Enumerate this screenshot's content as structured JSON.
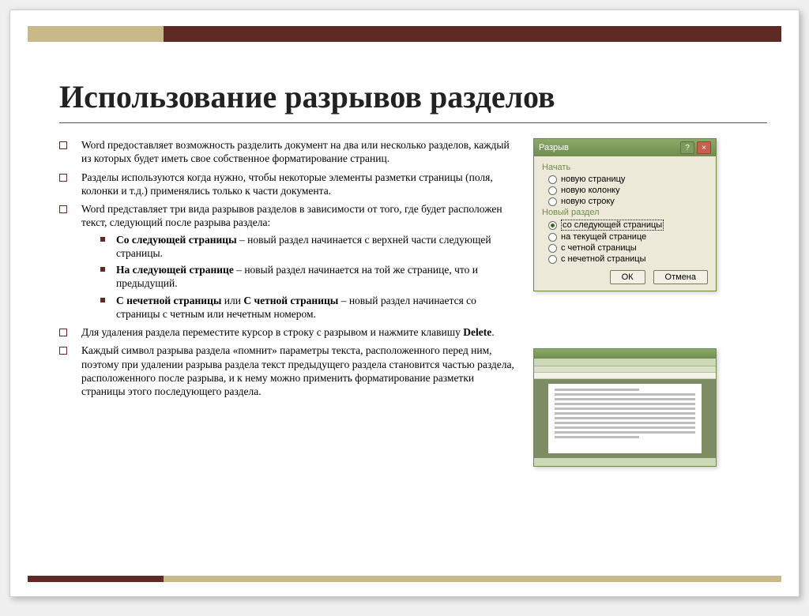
{
  "title": "Использование разрывов разделов",
  "bullets": {
    "b1": "Word предоставляет возможность разделить документ на два или несколько разделов, каждый из которых будет иметь свое собственное форматирование страниц.",
    "b2": "Разделы используются когда нужно, чтобы некоторые элементы разметки страницы (поля, колонки и т.д.) применялись только к части документа.",
    "b3": "Word представляет три вида разрывов разделов в зависимости от того, где будет расположен текст, следующий после разрыва раздела:",
    "b3a_bold": "Со следующей страницы",
    "b3a_rest": " – новый раздел начинается с верхней части следующей страницы.",
    "b3b_bold": "На следующей странице",
    "b3b_rest": " – новый раздел начинается на той же странице, что и предыдущий.",
    "b3c_bold1": "С нечетной страницы",
    "b3c_mid": " или ",
    "b3c_bold2": "С четной страницы",
    "b3c_rest": " – новый раздел начинается со страницы с четным или нечетным номером.",
    "b4_pre": "Для удаления раздела переместите курсор в строку с разрывом и нажмите клавишу ",
    "b4_bold": "Delete",
    "b4_post": ".",
    "b5": "Каждый символ разрыва раздела «помнит» параметры текста, расположенного перед ним, поэтому при удалении разрыва раздела текст предыдущего раздела становится частью раздела, расположенного после разрыва, и к нему можно применить форматирование разметки страницы этого последующего раздела."
  },
  "dialog": {
    "title": "Разрыв",
    "group1": "Начать",
    "r1": "новую страницу",
    "r2": "новую колонку",
    "r3": "новую строку",
    "group2": "Новый раздел",
    "r4": "со следующей страницы",
    "r5": "на текущей странице",
    "r6": "с четной страницы",
    "r7": "с нечетной страницы",
    "ok": "ОК",
    "cancel": "Отмена"
  }
}
